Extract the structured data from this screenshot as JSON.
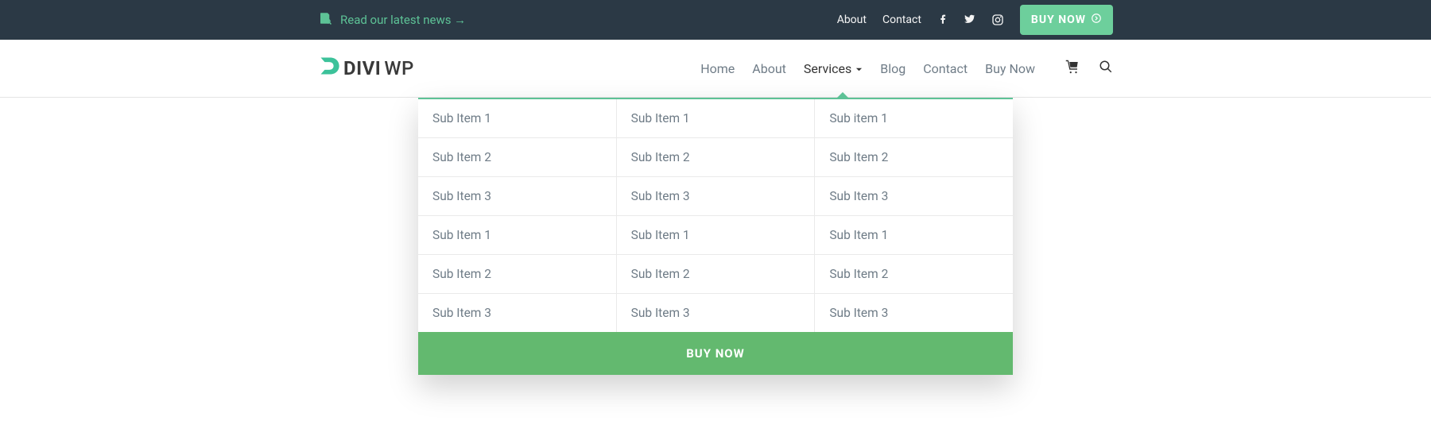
{
  "topbar": {
    "news_text": "Read our latest news →",
    "links": [
      "About",
      "Contact"
    ],
    "buy_label": "BUY NOW"
  },
  "logo": {
    "part1": "DIVI",
    "part2": "WP"
  },
  "nav": {
    "items": [
      {
        "label": "Home",
        "active": false
      },
      {
        "label": "About",
        "active": false
      },
      {
        "label": "Services",
        "active": true,
        "dropdown": true
      },
      {
        "label": "Blog",
        "active": false
      },
      {
        "label": "Contact",
        "active": false
      },
      {
        "label": "Buy Now",
        "active": false
      }
    ]
  },
  "mega": {
    "columns": [
      [
        "Sub Item 1",
        "Sub Item 2",
        "Sub Item 3",
        "Sub Item 1",
        "Sub Item 2",
        "Sub Item 3"
      ],
      [
        "Sub Item 1",
        "Sub Item 2",
        "Sub Item 3",
        "Sub Item 1",
        "Sub Item 2",
        "Sub Item 3"
      ],
      [
        "Sub item 1",
        "Sub Item 2",
        "Sub Item 3",
        "Sub Item 1",
        "Sub Item 2",
        "Sub Item 3"
      ]
    ],
    "cta": "BUY NOW"
  }
}
